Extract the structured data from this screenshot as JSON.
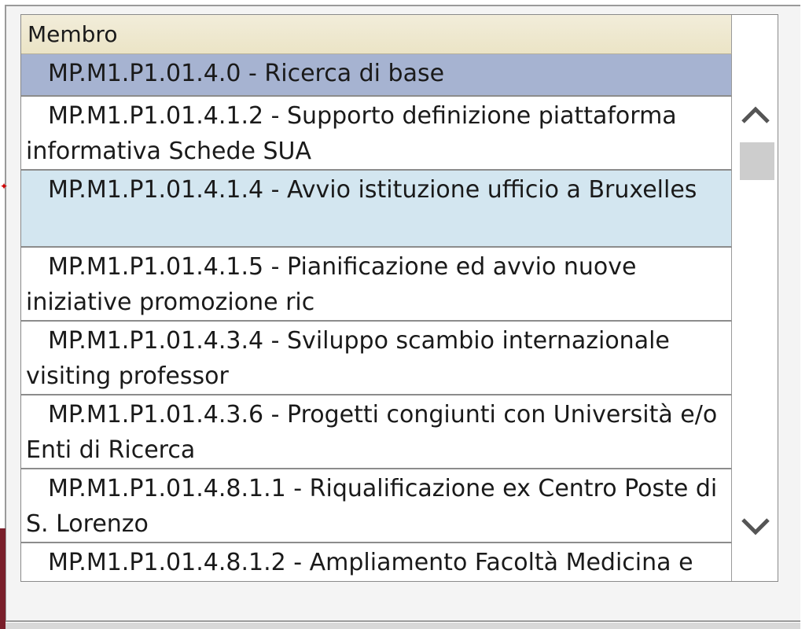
{
  "list": {
    "header": "Membro",
    "items": [
      {
        "code": "MP.M1.P1.01.4.0",
        "text": "Ricerca di base",
        "state": "selected"
      },
      {
        "code": "MP.M1.P1.01.4.1.2",
        "text": "Supporto definizione piattaforma informativa Schede SUA",
        "state": "normal"
      },
      {
        "code": "MP.M1.P1.01.4.1.4",
        "text": "Avvio istituzione ufficio a Bruxelles",
        "state": "hover"
      },
      {
        "code": "MP.M1.P1.01.4.1.5",
        "text": "Pianificazione ed avvio nuove iniziative promozione ric",
        "state": "normal"
      },
      {
        "code": "MP.M1.P1.01.4.3.4",
        "text": "Sviluppo scambio internazionale visiting professor",
        "state": "normal"
      },
      {
        "code": "MP.M1.P1.01.4.3.6",
        "text": "Progetti congiunti con Università e/o Enti di Ricerca",
        "state": "normal"
      },
      {
        "code": "MP.M1.P1.01.4.8.1.1",
        "text": "Riqualificazione ex Centro Poste di S. Lorenzo",
        "state": "normal"
      },
      {
        "code": "MP.M1.P1.01.4.8.1.2",
        "text": "Ampliamento Facoltà Medicina e",
        "state": "normal"
      }
    ]
  },
  "scrollbar": {
    "up_icon": "chevron-up-icon",
    "down_icon": "chevron-down-icon"
  },
  "colors": {
    "selected_row": "#a6b3d1",
    "hover_row": "#d3e6f0",
    "header": "#ebe4c6"
  }
}
